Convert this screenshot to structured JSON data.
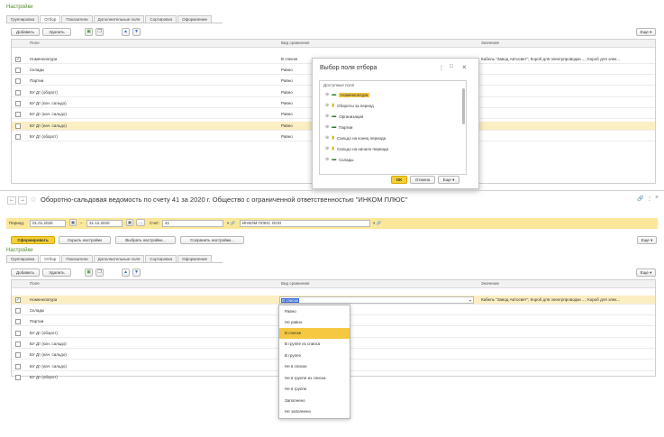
{
  "top": {
    "section_title": "Настройки",
    "tabs": [
      "Группировка",
      "Отбор",
      "Показатели",
      "Дополнительные поля",
      "Сортировка",
      "Оформление"
    ],
    "add_label": "Добавить",
    "delete_label": "Удалить",
    "more_label": "Еще ▾",
    "columns": {
      "field": "Поле",
      "comparison": "Вид сравнения",
      "value": "Значение"
    },
    "rows": [
      {
        "checked": true,
        "field": "Номенклатура",
        "comparison": "В списке",
        "value": "Кабель \"Завод Автосвет\"; Короб  для электрпроводки ...; Короб для элек..."
      },
      {
        "checked": false,
        "field": "Склады",
        "comparison": "Равно",
        "value": ""
      },
      {
        "checked": false,
        "field": "Партии",
        "comparison": "Равно",
        "value": ""
      },
      {
        "checked": false,
        "field": "БУ Дт (оборот)",
        "comparison": "Равно",
        "value": ""
      },
      {
        "checked": false,
        "field": "БУ Дт (кон. сальдо)",
        "comparison": "Равно",
        "value": ""
      },
      {
        "checked": false,
        "field": "БУ Дт (нач. сальдо)",
        "comparison": "Равно",
        "value": ""
      },
      {
        "checked": false,
        "field": "БУ Дт (нач. сальдо)",
        "comparison": "Равно",
        "value": ""
      },
      {
        "checked": false,
        "field": "БУ Дт (оборот)",
        "comparison": "Равно",
        "value": ""
      }
    ]
  },
  "dialog": {
    "title": "Выбор поля отбора",
    "menu_icon": "⋮",
    "max_icon": "□",
    "close_icon": "×",
    "tree_header": "Доступные поля",
    "items": [
      "Номенклатура",
      "Обороты за период",
      "Организация",
      "Партии",
      "Сальдо на конец периода",
      "Сальдо на начало периода",
      "Склады"
    ],
    "ok_label": "OK",
    "cancel_label": "Отмена",
    "more_label": "Еще ▾"
  },
  "report": {
    "title": "Оборотно-сальдовая ведомость по счету 41 за 2020 г. Общество с ограниченной ответственностью \"ИНКОМ ПЛЮС\"",
    "period_label": "Период:",
    "date_from": "01.01.2020",
    "date_to": "31.12.2020",
    "account_label": "Счет:",
    "account_value": "41",
    "org_value": "ИНКОМ ПЛЮС ООО",
    "generate_label": "Сформировать",
    "hide_settings_label": "Скрыть настройки",
    "choose_settings_label": "Выбрать настройки...",
    "save_settings_label": "Сохранить настройки...",
    "more_label": "Еще ▾"
  },
  "bottom": {
    "section_title": "Настройки",
    "tabs": [
      "Группировка",
      "Отбор",
      "Показатели",
      "Дополнительные поля",
      "Сортировка",
      "Оформление"
    ],
    "add_label": "Добавить",
    "delete_label": "Удалить",
    "more_label": "Еще ▾",
    "columns": {
      "field": "Поле",
      "comparison": "Вид сравнения",
      "value": "Значение"
    },
    "rows": [
      {
        "checked": true,
        "field": "Номенклатура",
        "comparison": "В списке",
        "value": "Кабель \"Завод Автосвет\"; Короб  для электрпроводки ...; Короб для элек..."
      },
      {
        "checked": false,
        "field": "Склады",
        "comparison": "",
        "value": ""
      },
      {
        "checked": false,
        "field": "Партии",
        "comparison": "",
        "value": ""
      },
      {
        "checked": false,
        "field": "БУ Дт (оборот)",
        "comparison": "",
        "value": ""
      },
      {
        "checked": false,
        "field": "БУ Дт (кон. сальдо)",
        "comparison": "",
        "value": ""
      },
      {
        "checked": false,
        "field": "БУ Дт (нач. сальдо)",
        "comparison": "",
        "value": ""
      },
      {
        "checked": false,
        "field": "БУ Дт (нач. сальдо)",
        "comparison": "",
        "value": ""
      },
      {
        "checked": false,
        "field": "БУ Дт (оборот)",
        "comparison": "",
        "value": ""
      }
    ]
  },
  "dropdown": {
    "options": [
      "Равно",
      "Не равно",
      "В списке",
      "В группе из списка",
      "В группе",
      "Не в списке",
      "Не в группе из списка",
      "Не в группе",
      "Заполнено",
      "Не заполнено"
    ],
    "selected": "В списке"
  },
  "colors": {
    "accent": "#f5d033",
    "title_green": "#4e8a2c",
    "selected_row": "#fbeec2"
  }
}
